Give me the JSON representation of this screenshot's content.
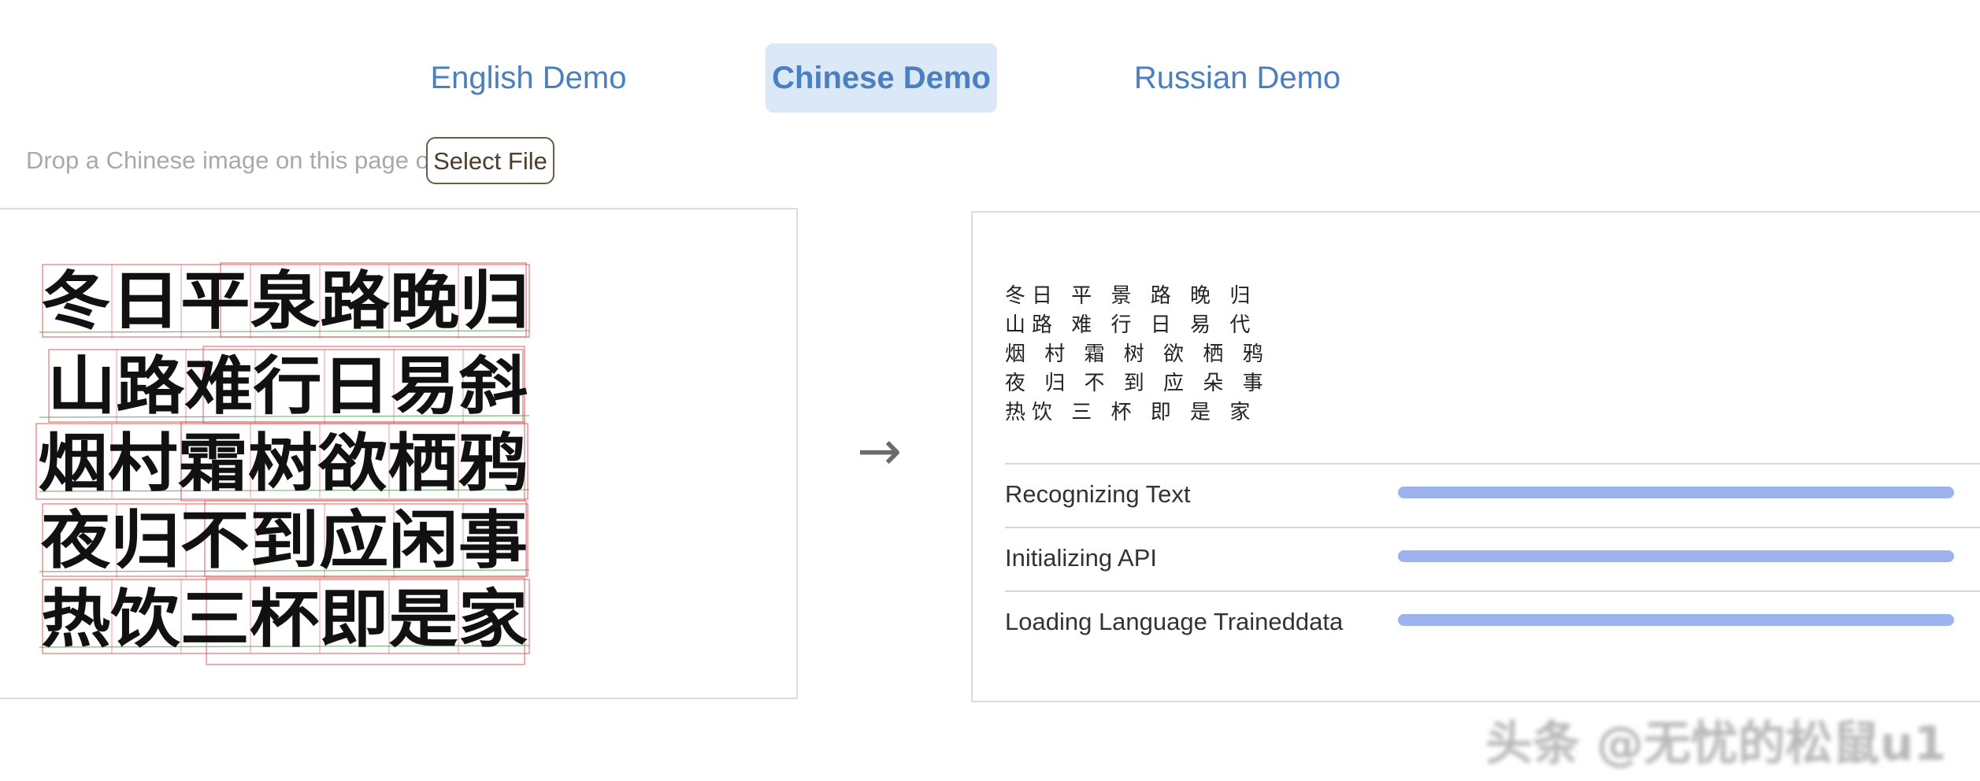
{
  "tabs": [
    {
      "label": "English Demo",
      "active": false
    },
    {
      "label": "Chinese Demo",
      "active": true
    },
    {
      "label": "Russian Demo",
      "active": false
    }
  ],
  "drop": {
    "text": "Drop a Chinese image on this page or",
    "button_label": "Select File"
  },
  "image_panel": {
    "lines": [
      "冬日平泉路晚归",
      "山路难行日易斜",
      "烟村霜树欲栖鸦",
      "夜归不到应闲事",
      "热饮三杯即是家"
    ]
  },
  "arrow": "→",
  "output": {
    "recognized_text": "冬日 平 景 路 晚 归\n山路 难 行 日 易 代\n烟 村 霜 树 欲 栖 鸦\n夜 归 不 到 应 朵 事\n热饮 三 杯 即 是 家",
    "statuses": [
      {
        "label": "Recognizing Text",
        "progress": 1.0
      },
      {
        "label": "Initializing API",
        "progress": 1.0
      },
      {
        "label": "Loading Language Traineddata",
        "progress": 1.0
      }
    ]
  },
  "watermark": "头条 @无忧的松鼠u1",
  "colors": {
    "tab_text": "#4a80bf",
    "tab_active_bg": "#dbe8f7",
    "progress_fill": "#9bb2ec",
    "bbox_red": "#e05555",
    "bbox_green": "#4a9a4a"
  }
}
